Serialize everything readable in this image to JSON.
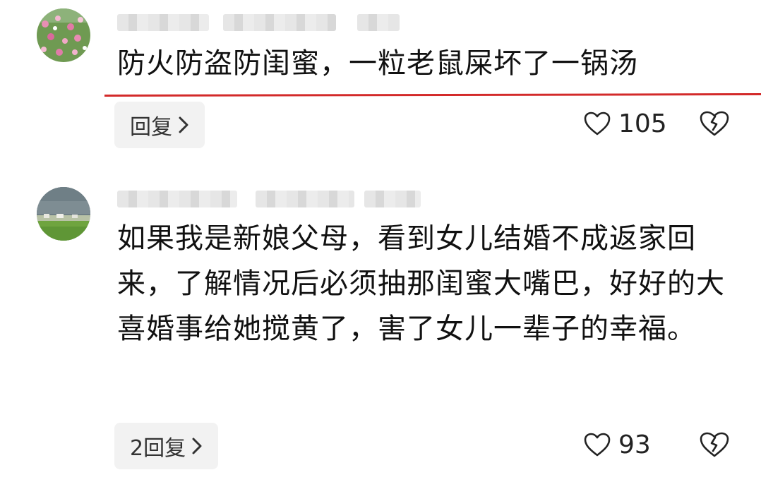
{
  "comments": [
    {
      "username": "",
      "text": "防火防盗防闺蜜，一粒老鼠屎坏了一锅汤",
      "reply_label": "回复",
      "likes": "105",
      "avatar_icon": "flower-field-avatar-icon"
    },
    {
      "username": "",
      "text": "如果我是新娘父母，看到女儿结婚不成返家回来，了解情况后必须抽那闺蜜大嘴巴，好好的大喜婚事给她搅黄了，害了女儿一辈子的幸福。",
      "reply_label": "2回复",
      "likes": "93",
      "avatar_icon": "landscape-avatar-icon"
    }
  ],
  "colors": {
    "highlight_line": "#d32a2a",
    "reply_bg": "#f2f2f2",
    "text": "#111111"
  },
  "icons": {
    "like": "heart-outline-icon",
    "dislike": "broken-heart-icon",
    "chevron": "chevron-right-icon"
  }
}
